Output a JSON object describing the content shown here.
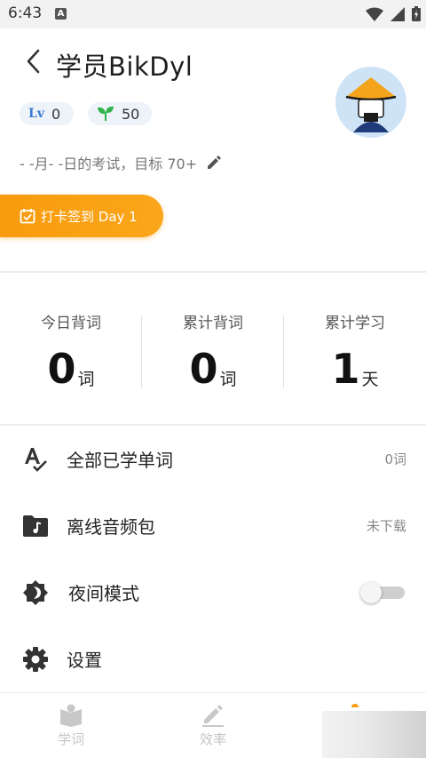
{
  "status_bar": {
    "time": "6:43",
    "notification_icon": "A"
  },
  "header": {
    "title": "学员BikDyl",
    "level": "0",
    "points": "50",
    "exam_info": "- -月- -日的考试，目标 70+",
    "checkin_label": "打卡签到 Day 1"
  },
  "stats": [
    {
      "label": "今日背词",
      "value": "0",
      "unit": "词"
    },
    {
      "label": "累计背词",
      "value": "0",
      "unit": "词"
    },
    {
      "label": "累计学习",
      "value": "1",
      "unit": "天"
    }
  ],
  "menu": [
    {
      "label": "全部已学单词",
      "value": "0词",
      "icon": "spellcheck-icon"
    },
    {
      "label": "离线音频包",
      "value": "未下载",
      "icon": "music-folder-icon"
    },
    {
      "label": "夜间模式",
      "value": "",
      "icon": "night-mode-icon",
      "toggle_on": false
    },
    {
      "label": "设置",
      "value": "",
      "icon": "gear-icon"
    }
  ],
  "bottom_nav": [
    {
      "label": "学词",
      "icon": "book-icon"
    },
    {
      "label": "效率",
      "icon": "pencil-icon"
    }
  ],
  "colors": {
    "accent": "#f89b0c",
    "level_blue": "#3a7bd5",
    "sprout_green": "#2fb34a"
  }
}
